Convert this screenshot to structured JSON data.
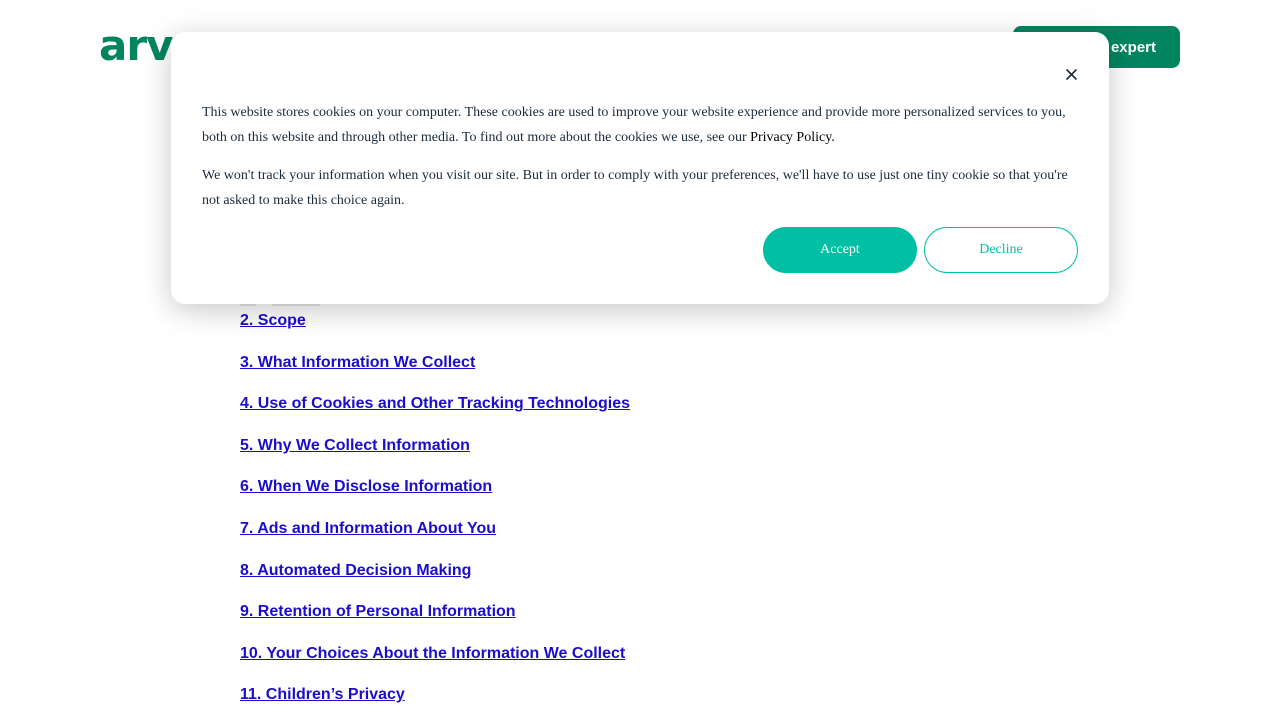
{
  "header": {
    "logo_text": "arve",
    "cta_label": "expert"
  },
  "toc": {
    "items": [
      "2. Scope",
      "3. What Information We Collect",
      "4. Use of Cookies and Other Tracking Technologies",
      "5. Why We Collect Information",
      "6. When We Disclose Information",
      "7. Ads and Information About You",
      "8. Automated Decision Making",
      "9. Retention of Personal Information",
      "10. Your Choices About the Information We Collect",
      "11. Children’s Privacy"
    ]
  },
  "cookie_banner": {
    "paragraph1": "This website stores cookies on your computer. These cookies are used to improve your website experience and provide more personalized services to you, both on this website and through other media. To find out more about the cookies we use, see our ",
    "privacy_link": "Privacy Policy.",
    "paragraph2": "We won't track your information when you visit our site. But in order to comply with your preferences, we'll have to use just one tiny cookie so that you're not asked to make this choice again.",
    "accept_label": "Accept",
    "decline_label": "Decline",
    "close_icon": "close-icon"
  },
  "colors": {
    "brand_green": "#00855f",
    "accent_teal": "#00bfa5",
    "link_blue": "#1a0dcc",
    "text_dark": "#1a2b3c"
  }
}
